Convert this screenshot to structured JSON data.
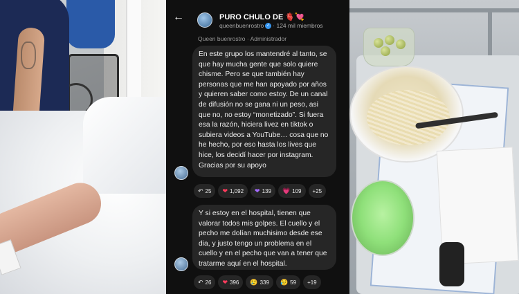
{
  "chat": {
    "header": {
      "back_icon": "arrow-left-icon",
      "title": "PURO CHULO DE 🫀💘",
      "owner": "queenbuenrostro",
      "verified_icon": "verified-badge-icon",
      "members": "· 124 mil miembros"
    },
    "sender": {
      "name": "Queen buenrostro",
      "role": "· Administrador"
    },
    "messages": [
      {
        "text": "En este grupo los mantendré al tanto, se que hay mucha gente que solo quiere chisme. Pero se que también hay personas que me han apoyado por años y quieren saber como estoy. De un canal de difusión no se gana ni un peso, asi que no, no estoy “monetizado”. Si fuera esa la razón, hiciera livez en tiktok o subiera videos a YouTube… cosa que no he hecho, por eso hasta los lives que hice, los decidí hacer por instagram. Gracias por su apoyo",
        "reactions": [
          {
            "icon": "reply-icon",
            "glyph": "↶",
            "count": "25"
          },
          {
            "icon": "red-heart-icon",
            "glyph": "❤",
            "count": "1,092"
          },
          {
            "icon": "purple-heart-icon",
            "glyph": "❤",
            "count": "139"
          },
          {
            "icon": "pink-heart-icon",
            "glyph": "💗",
            "count": "109"
          },
          {
            "icon": "more-reactions",
            "glyph": "",
            "count": "+25"
          }
        ]
      },
      {
        "text": "Y si estoy en el hospital, tienen que valorar todos mis golpes. El cuello y el pecho me dolían muchisimo desde ese dia, y justo tengo un problema en el cuello y en el pecho que van a tener que tratarme aquí en el hospital.",
        "reactions": [
          {
            "icon": "reply-icon",
            "glyph": "↶",
            "count": "26"
          },
          {
            "icon": "red-heart-icon",
            "glyph": "❤",
            "count": "396"
          },
          {
            "icon": "crying-face-icon",
            "glyph": "😢",
            "count": "339"
          },
          {
            "icon": "sad-face-icon",
            "glyph": "😥",
            "count": "59"
          },
          {
            "icon": "more-reactions",
            "glyph": "",
            "count": "+19"
          }
        ]
      }
    ]
  },
  "colors": {
    "chat_bg": "#101010",
    "bubble_bg": "#262626",
    "verified": "#3897f0"
  }
}
